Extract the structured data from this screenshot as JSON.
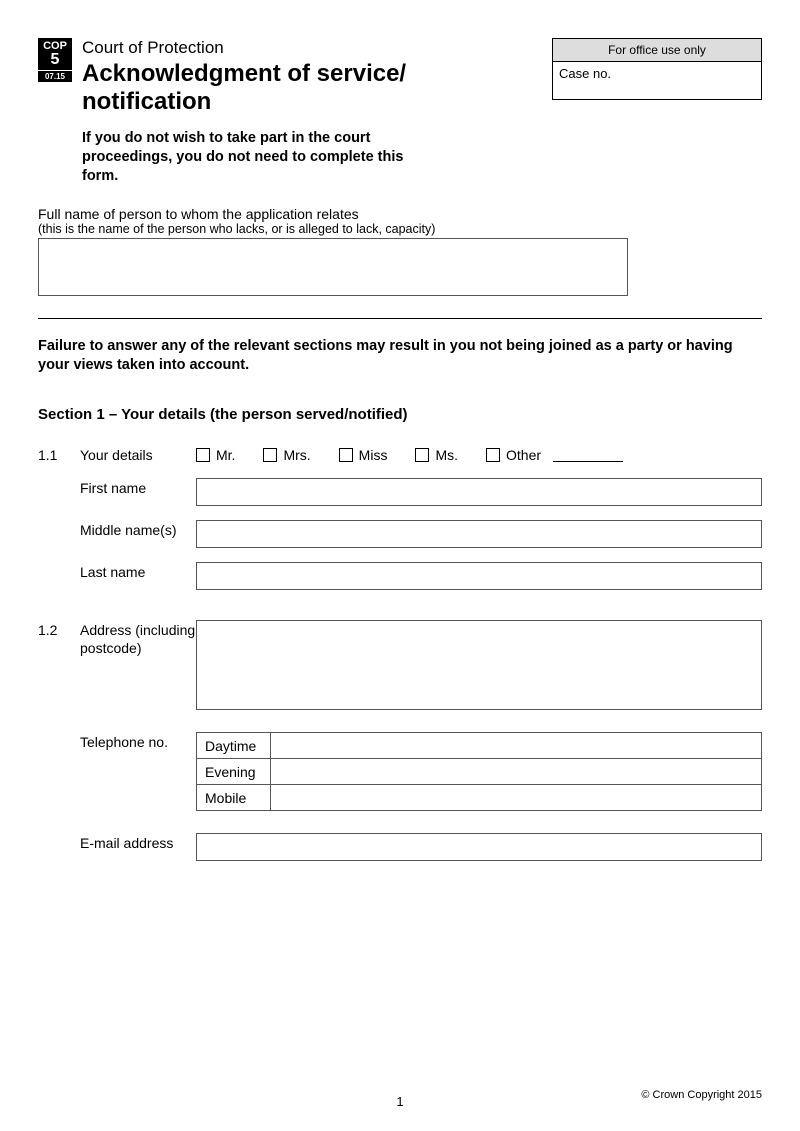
{
  "badge": {
    "cop": "COP",
    "num": "5",
    "date": "07.15"
  },
  "header": {
    "court": "Court of Protection",
    "title": "Acknowledgment of service/\nnotification",
    "instruction": "If you do not wish to take part in the court proceedings, you do not need to complete this form."
  },
  "office": {
    "header": "For office use only",
    "caseno_label": "Case no."
  },
  "fullname": {
    "label": "Full name of person to whom the application relates",
    "sub": "(this is the name of the person who lacks, or is alleged to lack, capacity)"
  },
  "warning": "Failure to answer any of the relevant sections may result in you not being joined as a party or having your views taken into account.",
  "section1": {
    "heading": "Section 1 – Your details (the person served/notified)",
    "q1_1": {
      "num": "1.1",
      "label": "Your details",
      "titles": {
        "mr": "Mr.",
        "mrs": "Mrs.",
        "miss": "Miss",
        "ms": "Ms.",
        "other": "Other"
      },
      "first_name": "First name",
      "middle_names": "Middle name(s)",
      "last_name": "Last name"
    },
    "q1_2": {
      "num": "1.2",
      "label": "Address (including postcode)",
      "telephone": "Telephone no.",
      "tel_daytime": "Daytime",
      "tel_evening": "Evening",
      "tel_mobile": "Mobile",
      "email": "E-mail address"
    }
  },
  "footer": {
    "page": "1",
    "copyright": "© Crown Copyright 2015"
  }
}
